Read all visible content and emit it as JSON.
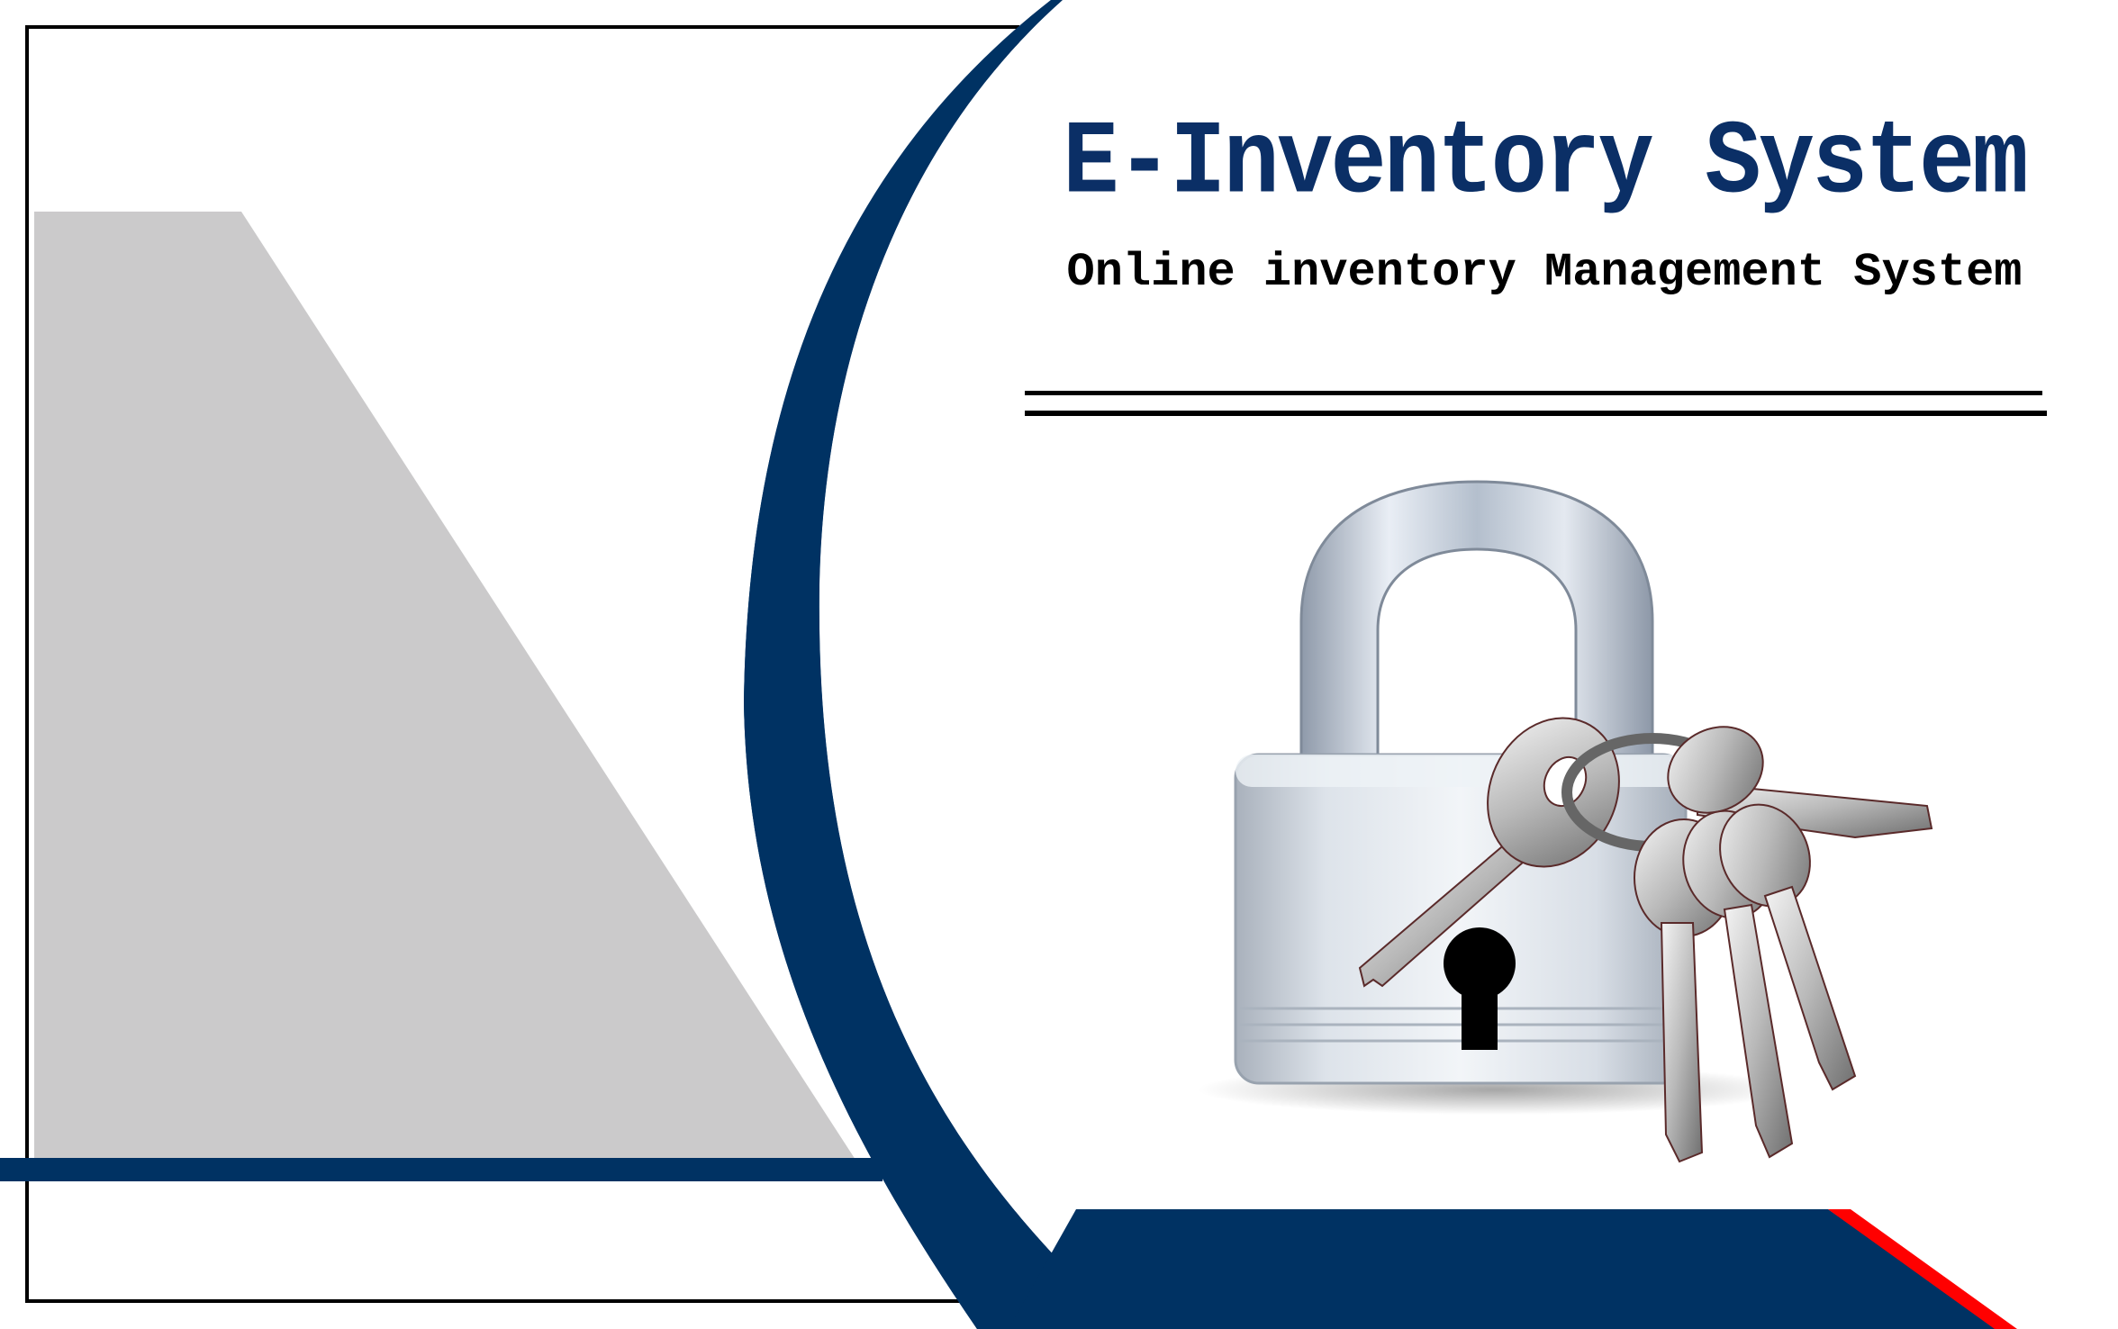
{
  "header": {
    "title": "E-Inventory System",
    "subtitle": "Online inventory Management System"
  },
  "colors": {
    "navy": "#003263",
    "title": "#0b2f66",
    "grey_panel": "#cbcacb",
    "accent_red": "#ff0000",
    "frame": "#000000"
  },
  "hero": {
    "icon": "padlock-with-keys-icon"
  }
}
